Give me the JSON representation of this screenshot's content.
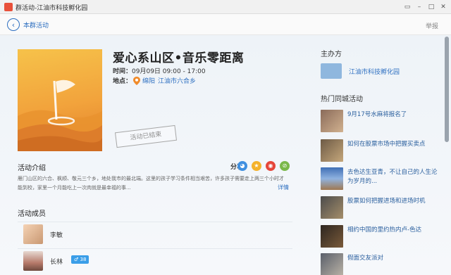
{
  "window": {
    "title": "群活动-江油市科技孵化园",
    "icon": "app-icon"
  },
  "nav": {
    "back_label": "本群活动",
    "report_label": "举报"
  },
  "event": {
    "title": "爱心系山区•音乐零距离",
    "time_label": "时间：",
    "time_value": "09月09日 09:00 - 17:00",
    "location_label": "地点：",
    "location_city": "绵阳",
    "location_address": "江油市六合乡",
    "status_stamp": "活动已结束"
  },
  "intro": {
    "heading": "活动介绍",
    "share_label": "分享:",
    "share_icons": [
      "qq-icon",
      "qzone-icon",
      "weibo-icon",
      "friends-icon"
    ],
    "text": "雁门山区的六合、枫顺、敬元三个乡，地处我市的最北端。这里的孩子学习条件相当艰苦，许多孩子需要走上两三个小时才能到校，家里一个月能吃上一次肉就是最幸福的事...",
    "more_label": "详情"
  },
  "members": {
    "heading": "活动成员",
    "items": [
      {
        "name": "李敏",
        "badge": ""
      },
      {
        "name": "长林",
        "badge": "38"
      }
    ]
  },
  "sidebar": {
    "organizer_heading": "主办方",
    "organizer_name": "江油市科技孵化园",
    "hot_heading": "热门同城活动",
    "hot_items": [
      {
        "title": "9月17号水麻将报名了"
      },
      {
        "title": "如何在股票市场中把握买卖点"
      },
      {
        "title": "去色达生亚青，不让自己的人生沦为岁月的..."
      },
      {
        "title": "股票如何把握进场和进场时机"
      },
      {
        "title": "相约中国的里约热内卢-色达"
      },
      {
        "title": "假面交友派对"
      }
    ]
  },
  "colors": {
    "accent": "#2d6fc0",
    "poster_orange": "#f2a33c",
    "badge_blue": "#3a9ee8"
  }
}
